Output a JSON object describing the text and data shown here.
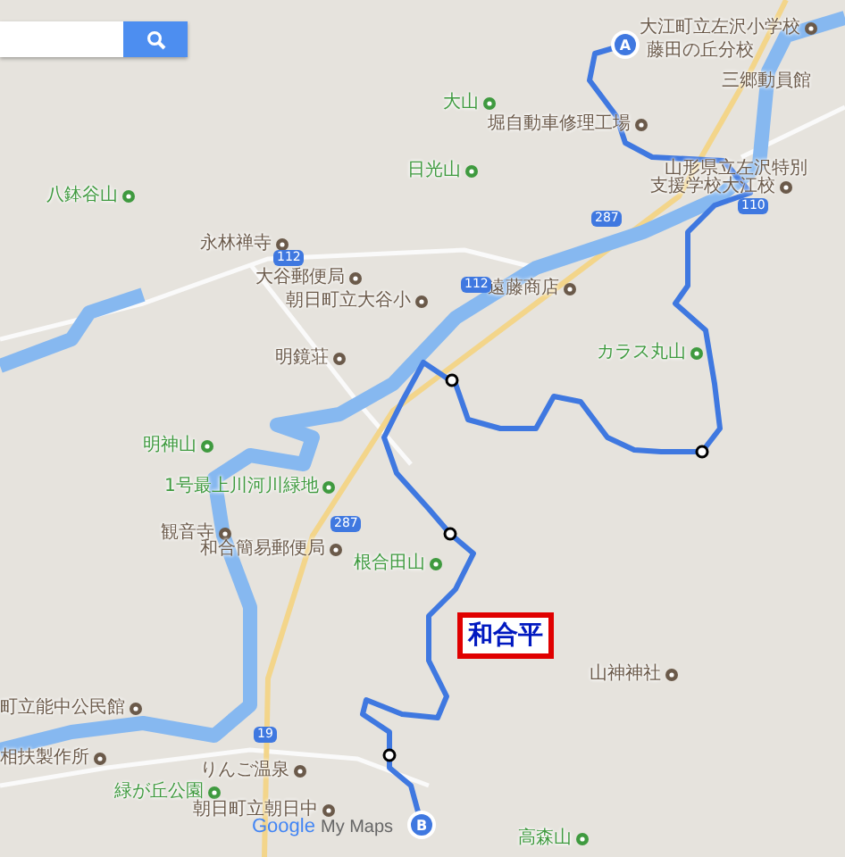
{
  "labels": [
    {
      "text": "大江町立左沢小学校",
      "kind": "poi"
    },
    {
      "text": "藤田の丘分校",
      "kind": "plain"
    },
    {
      "text": "三郷動員館",
      "kind": "plain"
    },
    {
      "text": "大山",
      "kind": "mountain"
    },
    {
      "text": "堀自動車修理工場",
      "kind": "poi"
    },
    {
      "text": "日光山",
      "kind": "mountain"
    },
    {
      "text": "八鉢谷山",
      "kind": "mountain"
    },
    {
      "text": "山形県立左沢特別",
      "kind": "plain"
    },
    {
      "text": "支援学校大江校",
      "kind": "poi"
    },
    {
      "text": "永林禅寺",
      "kind": "poi"
    },
    {
      "text": "大谷郵便局",
      "kind": "poi"
    },
    {
      "text": "遠藤商店",
      "kind": "poi"
    },
    {
      "text": "朝日町立大谷小",
      "kind": "poi"
    },
    {
      "text": "明鏡荘",
      "kind": "poi"
    },
    {
      "text": "カラス丸山",
      "kind": "mountain"
    },
    {
      "text": "明神山",
      "kind": "mountain"
    },
    {
      "text": "1号最上川河川緑地",
      "kind": "mountain"
    },
    {
      "text": "観音寺",
      "kind": "poi"
    },
    {
      "text": "和合簡易郵便局",
      "kind": "poi"
    },
    {
      "text": "根合田山",
      "kind": "mountain"
    },
    {
      "text": "山神神社",
      "kind": "poi"
    },
    {
      "text": "町立能中公民館",
      "kind": "poi"
    },
    {
      "text": "相扶製作所",
      "kind": "poi"
    },
    {
      "text": "りんご温泉",
      "kind": "poi"
    },
    {
      "text": "緑が丘公園",
      "kind": "mountain"
    },
    {
      "text": "朝日町立朝日中",
      "kind": "poi"
    },
    {
      "text": "高森山",
      "kind": "mountain"
    }
  ],
  "shields": [
    "112",
    "112",
    "287",
    "110",
    "287",
    "19"
  ],
  "markers": [
    "A",
    "B"
  ],
  "callout": "和合平",
  "logo": {
    "brand": "Google",
    "product": "My Maps"
  }
}
